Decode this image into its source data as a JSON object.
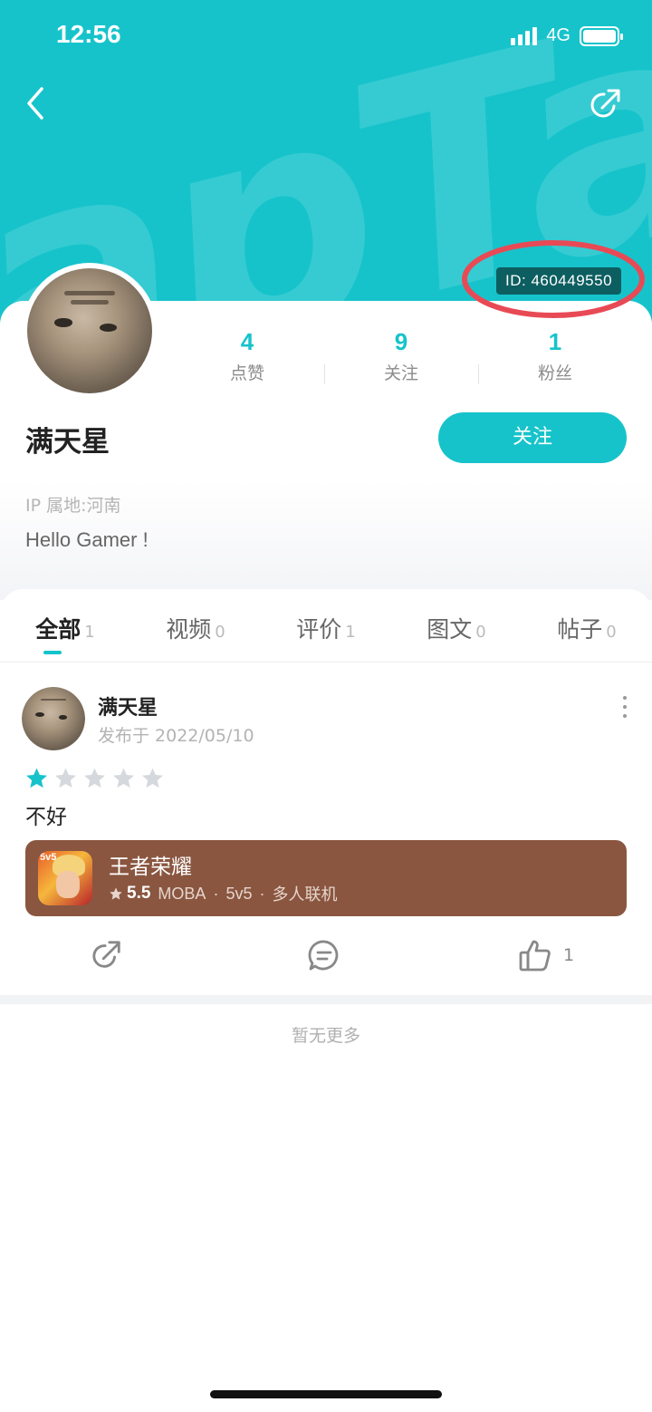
{
  "status_bar": {
    "time": "12:56",
    "network": "4G"
  },
  "colors": {
    "accent": "#16c3cb",
    "annotation": "#e84a55",
    "game_card": "#8a5640"
  },
  "header": {
    "watermark": "apTap",
    "back_icon": "chevron-left-icon",
    "share_icon": "share-icon"
  },
  "profile": {
    "id_label": "ID: 460449550",
    "stats": [
      {
        "value": "4",
        "label": "点赞"
      },
      {
        "value": "9",
        "label": "关注"
      },
      {
        "value": "1",
        "label": "粉丝"
      }
    ],
    "name": "满天星",
    "follow_label": "关注",
    "ip_location": "IP 属地:河南",
    "bio": "Hello Gamer !"
  },
  "tabs": [
    {
      "label": "全部",
      "count": "1",
      "active": true
    },
    {
      "label": "视频",
      "count": "0"
    },
    {
      "label": "评价",
      "count": "1"
    },
    {
      "label": "图文",
      "count": "0"
    },
    {
      "label": "帖子",
      "count": "0"
    }
  ],
  "post": {
    "author": "满天星",
    "date": "发布于 2022/05/10",
    "rating": 1,
    "rating_max": 5,
    "text": "不好",
    "game": {
      "icon_tag": "5v5",
      "name": "王者荣耀",
      "score": "5.5",
      "genre": "MOBA",
      "mode": "5v5",
      "feature": "多人联机"
    },
    "likes": "1"
  },
  "footer": {
    "no_more": "暂无更多"
  }
}
